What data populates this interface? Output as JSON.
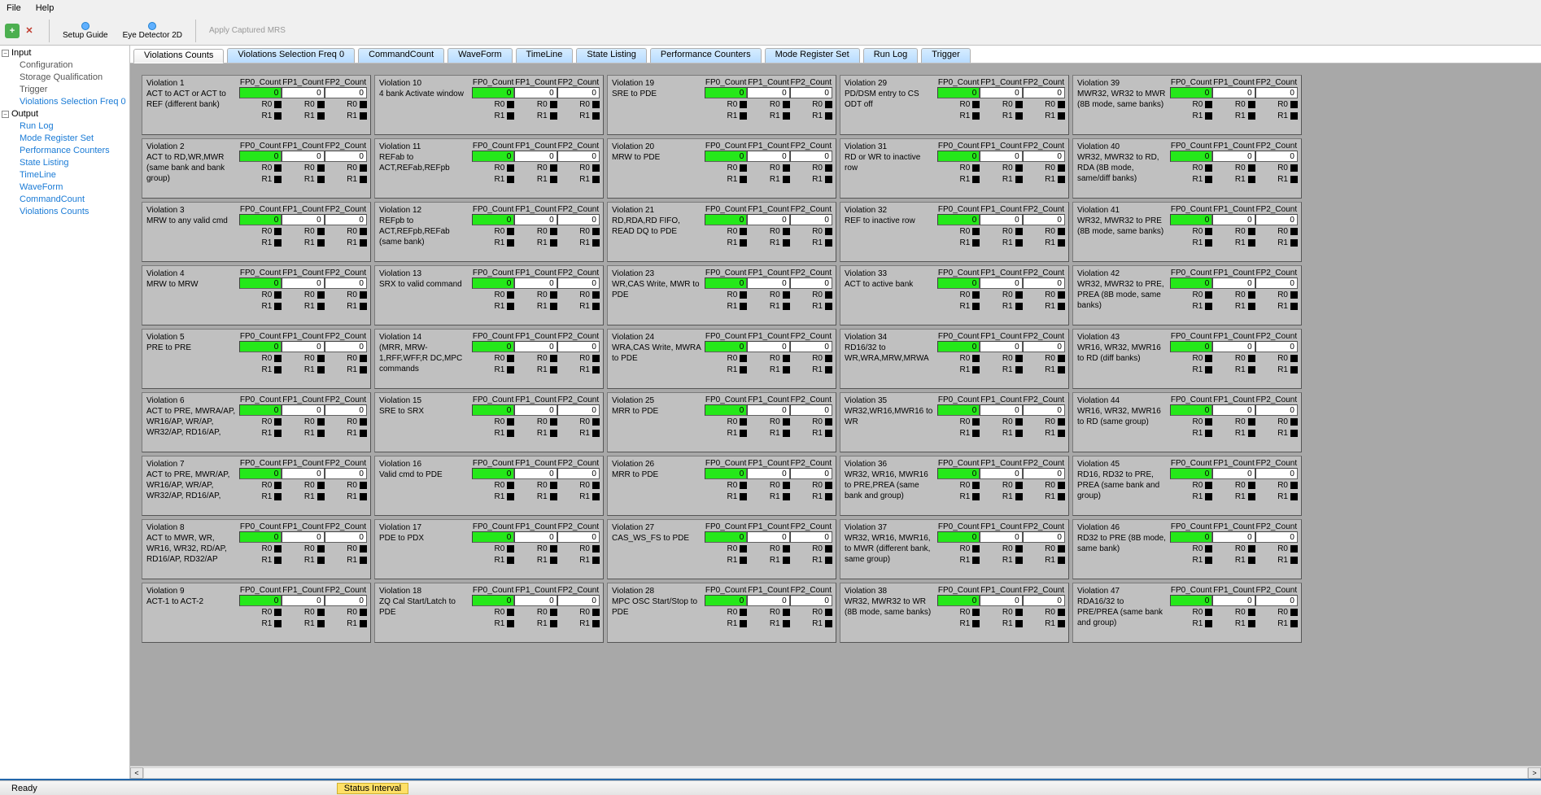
{
  "menu": {
    "file": "File",
    "help": "Help"
  },
  "toolbar": {
    "add": "+",
    "close": "✕",
    "setup_guide": "Setup Guide",
    "eye_detector": "Eye Detector 2D",
    "apply_mrs": "Apply Captured MRS"
  },
  "tree": {
    "input": "Input",
    "input_children": [
      "Configuration",
      "Storage Qualification",
      "Trigger",
      "Violations Selection Freq 0"
    ],
    "output": "Output",
    "output_children": [
      "Run Log",
      "Mode Register Set",
      "Performance Counters",
      "State Listing",
      "TimeLine",
      "WaveForm",
      "CommandCount",
      "Violations Counts"
    ]
  },
  "tabs": [
    {
      "label": "Violations Counts",
      "sel": true,
      "blue": false
    },
    {
      "label": "Violations Selection Freq 0",
      "sel": false,
      "blue": true
    },
    {
      "label": "CommandCount",
      "sel": false,
      "blue": true
    },
    {
      "label": "WaveForm",
      "sel": false,
      "blue": true
    },
    {
      "label": "TimeLine",
      "sel": false,
      "blue": true
    },
    {
      "label": "State Listing",
      "sel": false,
      "blue": true
    },
    {
      "label": "Performance Counters",
      "sel": false,
      "blue": true
    },
    {
      "label": "Mode Register Set",
      "sel": false,
      "blue": true
    },
    {
      "label": "Run Log",
      "sel": false,
      "blue": true
    },
    {
      "label": "Trigger",
      "sel": false,
      "blue": true
    }
  ],
  "card_columns": [
    "FP0_Count",
    "FP1_Count",
    "FP2_Count"
  ],
  "card_rows": [
    "R0",
    "R1"
  ],
  "card_value": "0",
  "cards": [
    [
      "Violation 1",
      "ACT to ACT or ACT to REF (different bank)"
    ],
    [
      "Violation 2",
      "ACT to RD,WR,MWR (same bank and bank group)"
    ],
    [
      "Violation 3",
      "MRW to any valid cmd"
    ],
    [
      "Violation 4",
      "MRW to MRW"
    ],
    [
      "Violation 5",
      "PRE to PRE"
    ],
    [
      "Violation 6",
      "ACT to PRE, MWRA/AP, WR16/AP, WR/AP, WR32/AP, RD16/AP,"
    ],
    [
      "Violation 7",
      "ACT to PRE, MWR/AP, WR16/AP, WR/AP, WR32/AP, RD16/AP,"
    ],
    [
      "Violation 8",
      "ACT to MWR, WR, WR16, WR32, RD/AP, RD16/AP, RD32/AP"
    ],
    [
      "Violation 9",
      "ACT-1 to ACT-2"
    ],
    [
      "Violation 10",
      "4 bank Activate window"
    ],
    [
      "Violation 11",
      "REFab to ACT,REFab,REFpb"
    ],
    [
      "Violation 12",
      "REFpb to ACT,REFpb,REFab (same bank)"
    ],
    [
      "Violation 13",
      "SRX to valid command"
    ],
    [
      "Violation 14",
      "(MRR, MRW-1,RFF,WFF,R DC,MPC commands"
    ],
    [
      "Violation 15",
      "SRE to SRX"
    ],
    [
      "Violation 16",
      "Valid cmd to PDE"
    ],
    [
      "Violation 17",
      "PDE to PDX"
    ],
    [
      "Violation 18",
      "ZQ Cal Start/Latch to PDE"
    ],
    [
      "Violation 19",
      "SRE to PDE"
    ],
    [
      "Violation 20",
      "MRW to PDE"
    ],
    [
      "Violation 21",
      "RD,RDA,RD FIFO, READ DQ to PDE"
    ],
    [
      "Violation 23",
      "WR,CAS Write, MWR to PDE"
    ],
    [
      "Violation 24",
      "WRA,CAS Write, MWRA to PDE"
    ],
    [
      "Violation 25",
      "MRR to PDE"
    ],
    [
      "Violation 26",
      "MRR to PDE"
    ],
    [
      "Violation 27",
      "CAS_WS_FS to PDE"
    ],
    [
      "Violation 28",
      "MPC OSC Start/Stop to PDE"
    ],
    [
      "Violation 29",
      "PD/DSM entry to CS ODT off"
    ],
    [
      "Violation 31",
      "RD or WR to inactive row"
    ],
    [
      "Violation 32",
      "REF to inactive row"
    ],
    [
      "Violation 33",
      "ACT to active bank"
    ],
    [
      "Violation 34",
      "RD16/32 to WR,WRA,MRW,MRWA"
    ],
    [
      "Violation 35",
      "WR32,WR16,MWR16 to WR"
    ],
    [
      "Violation 36",
      "WR32, WR16, MWR16 to PRE,PREA (same bank and group)"
    ],
    [
      "Violation 37",
      "WR32, WR16, MWR16, to MWR (different bank, same group)"
    ],
    [
      "Violation 38",
      "WR32, MWR32 to WR (8B mode, same banks)"
    ],
    [
      "Violation 39",
      "MWR32, WR32 to MWR (8B mode, same banks)"
    ],
    [
      "Violation 40",
      "WR32, MWR32 to RD, RDA (8B mode, same/diff banks)"
    ],
    [
      "Violation 41",
      "WR32, MWR32 to PRE (8B mode, same banks)"
    ],
    [
      "Violation 42",
      "WR32, MWR32 to PRE, PREA (8B mode, same banks)"
    ],
    [
      "Violation 43",
      "WR16, WR32, MWR16 to RD (diff banks)"
    ],
    [
      "Violation 44",
      "WR16, WR32, MWR16 to RD (same group)"
    ],
    [
      "Violation 45",
      "RD16, RD32 to PRE, PREA (same bank and group)"
    ],
    [
      "Violation 46",
      "RD32 to PRE (8B mode, same bank)"
    ],
    [
      "Violation 47",
      "RDA16/32 to PRE/PREA (same bank and group)"
    ]
  ],
  "status": {
    "ready": "Ready",
    "interval": "Status Interval"
  }
}
